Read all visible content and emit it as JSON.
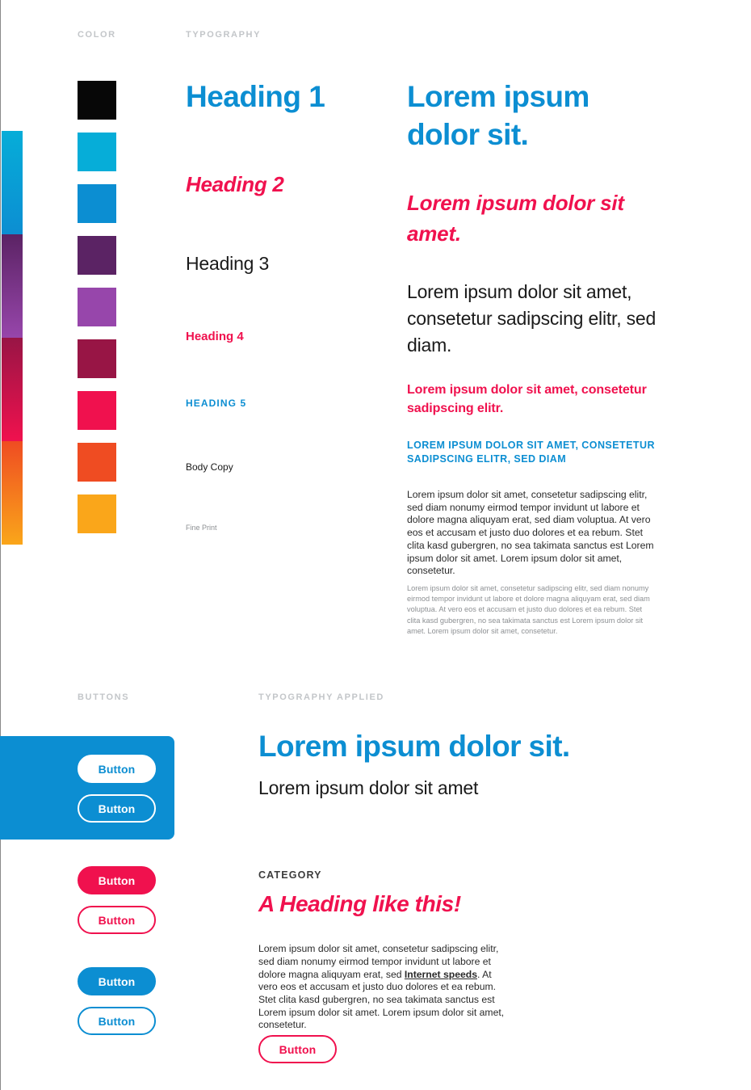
{
  "sections": {
    "color": "Color",
    "typography": "Typography",
    "buttons": "Buttons",
    "typography_applied": "Typography Applied"
  },
  "palette": {
    "swatches": [
      {
        "name": "black",
        "hex": "#070707"
      },
      {
        "name": "cyan",
        "hex": "#06add8"
      },
      {
        "name": "blue",
        "hex": "#0c8ed2"
      },
      {
        "name": "deep-purple",
        "hex": "#5b2364"
      },
      {
        "name": "purple",
        "hex": "#9746ab"
      },
      {
        "name": "maroon",
        "hex": "#981545"
      },
      {
        "name": "pink",
        "hex": "#f0114e"
      },
      {
        "name": "orange-red",
        "hex": "#ef4c22"
      },
      {
        "name": "amber",
        "hex": "#faa61a"
      }
    ],
    "gradients": [
      {
        "name": "cyan-to-blue",
        "from": "#06add8",
        "to": "#0c8ed2"
      },
      {
        "name": "deep-purple-to-purple",
        "from": "#5b2364",
        "to": "#9746ab"
      },
      {
        "name": "maroon-to-pink",
        "from": "#981545",
        "to": "#f0114e"
      },
      {
        "name": "orange-to-amber",
        "from": "#ef4c22",
        "to": "#faa61a"
      }
    ]
  },
  "type_scale": [
    {
      "key": "h1",
      "label": "Heading 1",
      "color": "#0c8ed2"
    },
    {
      "key": "h2",
      "label": "Heading 2",
      "color": "#f0114e"
    },
    {
      "key": "h3",
      "label": "Heading 3",
      "color": "#1a1a1a"
    },
    {
      "key": "h4",
      "label": "Heading 4",
      "color": "#f0114e"
    },
    {
      "key": "h5",
      "label": "HEADING 5",
      "color": "#0c8ed2"
    },
    {
      "key": "body",
      "label": "Body Copy",
      "color": "#1a1a1a"
    },
    {
      "key": "fine",
      "label": "Fine Print",
      "color": "#8d9093"
    }
  ],
  "specimens": {
    "h1": "Lorem ipsum dolor sit.",
    "h2": "Lorem ipsum dolor sit amet.",
    "h3": "Lorem ipsum dolor sit amet, consetetur sadipscing elitr, sed diam.",
    "h4": "Lorem ipsum dolor sit amet, consetetur sadipscing elitr.",
    "h5": "LOREM IPSUM DOLOR SIT AMET, CONSETETUR SADIPSCING ELITR, SED DIAM",
    "body": "Lorem ipsum dolor sit amet, consetetur sadipscing elitr, sed diam nonumy eirmod tempor invidunt ut labore et dolore magna aliquyam erat, sed diam voluptua. At vero eos et accusam et justo duo dolores et ea rebum. Stet clita kasd gubergren, no sea takimata sanctus est Lorem ipsum dolor sit amet. Lorem ipsum dolor sit amet, consetetur.",
    "fine": "Lorem ipsum dolor sit amet, consetetur sadipscing elitr, sed diam nonumy eirmod tempor invidunt ut labore et dolore magna aliquyam erat, sed diam voluptua. At vero eos et accusam et justo duo dolores et ea rebum. Stet clita kasd gubergren, no sea takimata sanctus est Lorem ipsum dolor sit amet. Lorem ipsum dolor sit amet, consetetur."
  },
  "buttons": {
    "on_blue_solid": "Button",
    "on_blue_outline": "Button",
    "pink_solid": "Button",
    "pink_outline": "Button",
    "blue_solid": "Button",
    "blue_outline": "Button",
    "applied_outline": "Button"
  },
  "applied": {
    "headline": "Lorem ipsum dolor sit.",
    "subhead": "Lorem ipsum dolor sit amet",
    "category": "CATEGORY",
    "heading": "A Heading like this!",
    "body_part1": "Lorem ipsum dolor sit amet, consetetur sadipscing elitr, sed diam nonumy eirmod tempor invidunt ut labore et dolore magna aliquyam erat, sed ",
    "body_link": "Internet speeds",
    "body_part2": ". At vero eos et accusam et justo duo dolores et ea rebum. Stet clita kasd gubergren, no sea takimata sanctus est Lorem ipsum dolor sit amet. Lorem ipsum dolor sit amet, consetetur."
  }
}
